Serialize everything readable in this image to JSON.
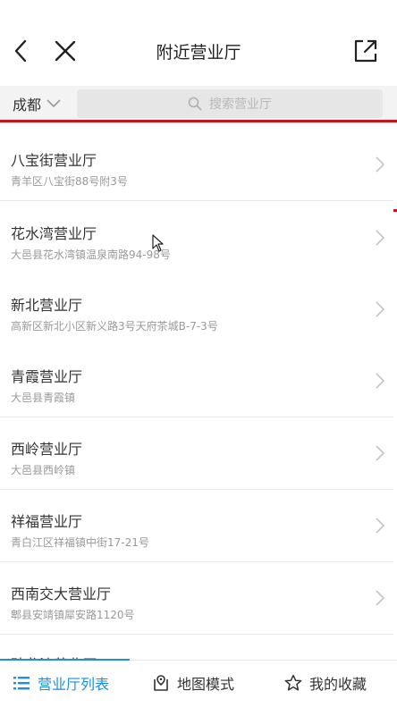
{
  "header": {
    "title": "附近营业厅",
    "back_icon": "chevron-left-icon",
    "close_icon": "close-icon",
    "share_icon": "external-link-icon"
  },
  "search": {
    "city": "成都",
    "placeholder": "搜索营业厅"
  },
  "accent": "#1a8fe3",
  "highlight": "#c8151b",
  "list": [
    {
      "name": "八宝街营业厅",
      "address": "青羊区八宝街88号附3号"
    },
    {
      "name": "花水湾营业厅",
      "address": "大邑县花水湾镇温泉南路94-98号"
    },
    {
      "name": "新北营业厅",
      "address": "高新区新北小区新义路3号天府茶城B-7-3号"
    },
    {
      "name": "青霞营业厅",
      "address": "大邑县青霞镇"
    },
    {
      "name": "西岭营业厅",
      "address": "大邑县西岭镇"
    },
    {
      "name": "祥福营业厅",
      "address": "青白江区祥福镇中街17-21号"
    },
    {
      "name": "西南交大营业厅",
      "address": "郫县安靖镇犀安路1120号"
    }
  ],
  "partial_item": {
    "name": "孙龙沙营业厅"
  },
  "tabs": [
    {
      "label": "营业厅列表",
      "icon": "list-icon",
      "active": true
    },
    {
      "label": "地图模式",
      "icon": "map-icon",
      "active": false
    },
    {
      "label": "我的收藏",
      "icon": "star-icon",
      "active": false
    }
  ]
}
